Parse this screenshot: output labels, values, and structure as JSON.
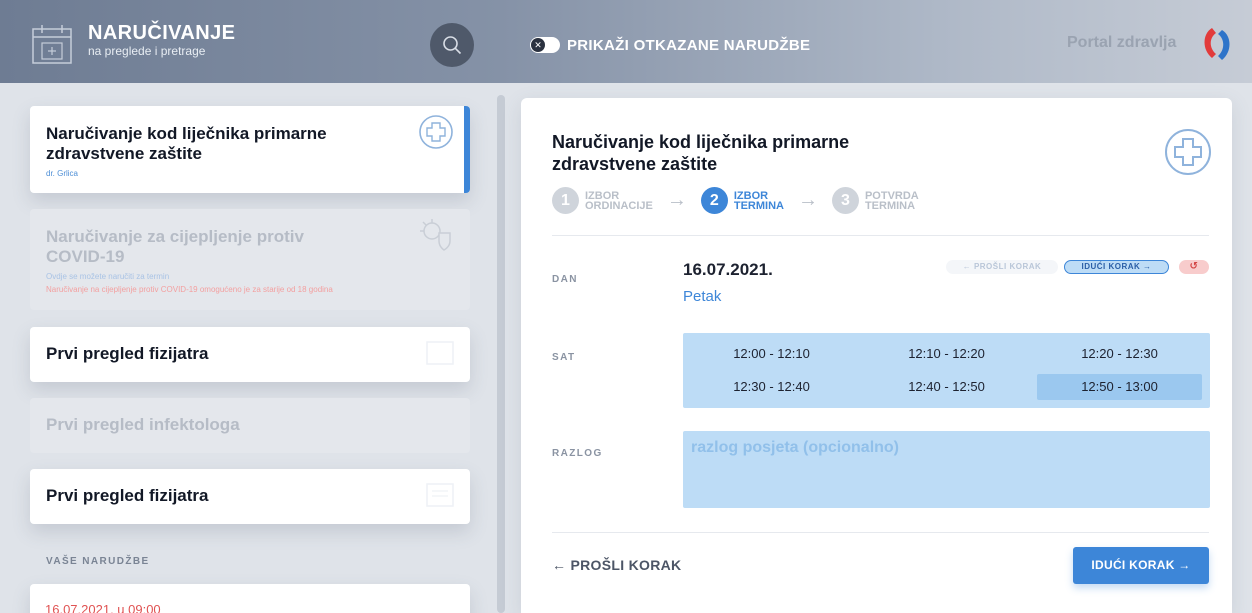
{
  "header": {
    "title": "NARUČIVANJE",
    "subtitle": "na preglede i pretrage",
    "toggle_label": "PRIKAŽI OTKAZANE NARUDŽBE",
    "toggle_knob": "✕",
    "portal_name": "Portal zdravlja"
  },
  "sidebar": {
    "cards": [
      {
        "title": "Naručivanje kod liječnika primarne zdravstvene zaštite",
        "sub": "dr. Grlica"
      },
      {
        "title": "Naručivanje za cijepljenje protiv COVID-19",
        "sub": "Ovdje se možete naručiti za termin",
        "sub2": "Naručivanje na cijepljenje protiv COVID-19 omogućeno je za starije od 18 godina"
      },
      {
        "title": "Prvi pregled fizijatra"
      },
      {
        "title": "Prvi pregled infektologa"
      },
      {
        "title": "Prvi pregled fizijatra"
      }
    ],
    "orders_label": "VAŠE NARUDŽBE",
    "order_date": "16.07.2021. u 09:00"
  },
  "main": {
    "title": "Naručivanje kod liječnika primarne zdravstvene zaštite",
    "steps": [
      {
        "num": "1",
        "line1": "IZBOR",
        "line2": "ORDINACIJE",
        "active": false
      },
      {
        "num": "2",
        "line1": "IZBOR",
        "line2": "TERMINA",
        "active": true
      },
      {
        "num": "3",
        "line1": "POTVRDA",
        "line2": "TERMINA",
        "active": false
      }
    ],
    "day_label": "DAN",
    "date": "16.07.2021.",
    "day_name": "Petak",
    "prev_pill": "← PROŠLI KORAK",
    "next_pill": "IDUĆI KORAK →",
    "reset_icon": "↺",
    "time_label": "SAT",
    "slots": [
      "12:00 - 12:10",
      "12:10 - 12:20",
      "12:20 - 12:30",
      "12:30 - 12:40",
      "12:40 - 12:50",
      "12:50 - 13:00"
    ],
    "selected_slot": "12:50 - 13:00",
    "reason_label": "RAZLOG",
    "reason_placeholder": "razlog posjeta (opcionalno)",
    "back_link": "← PROŠLI KORAK",
    "next_button": "IDUĆI KORAK →"
  }
}
